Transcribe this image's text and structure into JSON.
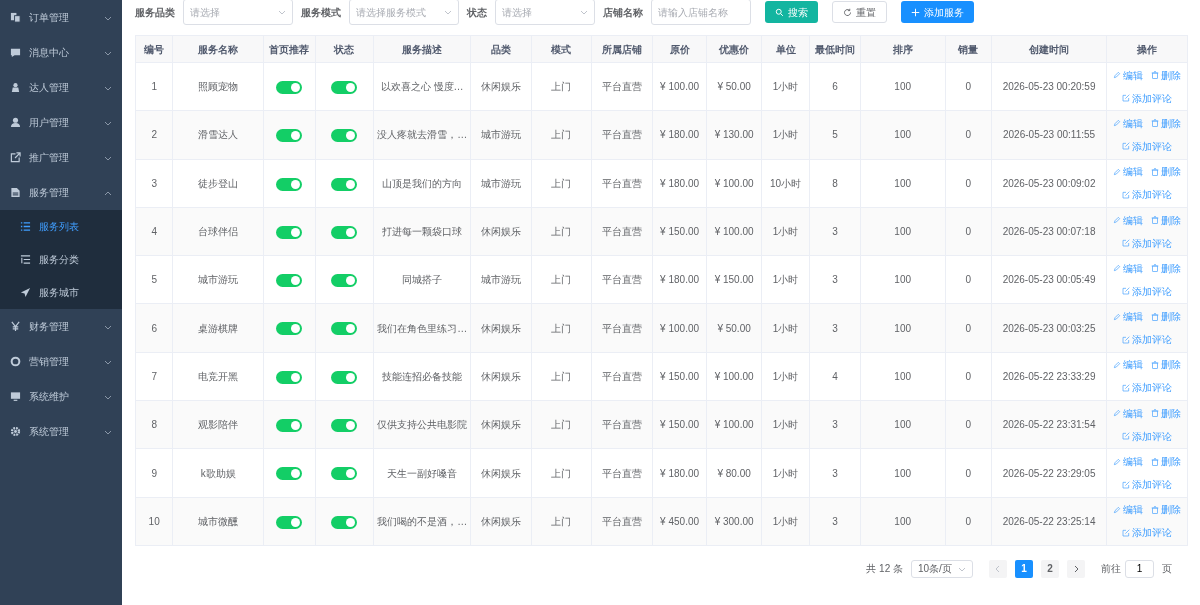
{
  "sidebar": {
    "items": [
      {
        "label": "订单管理",
        "expanded": false
      },
      {
        "label": "消息中心",
        "expanded": false
      },
      {
        "label": "达人管理",
        "expanded": false
      },
      {
        "label": "用户管理",
        "expanded": false
      },
      {
        "label": "推广管理",
        "expanded": false
      },
      {
        "label": "服务管理",
        "expanded": true,
        "children": [
          {
            "label": "服务列表",
            "selected": true
          },
          {
            "label": "服务分类",
            "selected": false
          },
          {
            "label": "服务城市",
            "selected": false
          }
        ]
      },
      {
        "label": "财务管理",
        "expanded": false
      },
      {
        "label": "营销管理",
        "expanded": false
      },
      {
        "label": "系统维护",
        "expanded": false
      },
      {
        "label": "系统管理",
        "expanded": false
      }
    ]
  },
  "filters": [
    {
      "label": "服务品类",
      "placeholder": "请选择",
      "kind": "select"
    },
    {
      "label": "服务模式",
      "placeholder": "请选择服务模式",
      "kind": "select"
    },
    {
      "label": "状态",
      "placeholder": "请选择",
      "kind": "select"
    },
    {
      "label": "店铺名称",
      "placeholder": "请输入店铺名称",
      "kind": "input"
    }
  ],
  "buttons": [
    {
      "label": "搜索",
      "kind": "search"
    },
    {
      "label": "重置",
      "kind": "reset"
    },
    {
      "label": "添加服务",
      "kind": "add"
    }
  ],
  "table": {
    "columns": [
      "编号",
      "服务名称",
      "首页推荐",
      "状态",
      "服务描述",
      "品类",
      "模式",
      "所属店铺",
      "原价",
      "优惠价",
      "单位",
      "最低时间",
      "排序",
      "销量",
      "创建时间",
      "操作"
    ],
    "rows": [
      {
        "id": "1",
        "name": "照顾宠物",
        "recommended": true,
        "enabled": true,
        "desc": "以欢喜之心 慢度…",
        "category": "休闲娱乐",
        "mode": "上门",
        "shop": "平台直营",
        "price": "¥ 100.00",
        "discount": "¥ 50.00",
        "unit": "1小时",
        "min": "6",
        "sort": "100",
        "sales": "0",
        "created": "2026-05-23 00:20:59",
        "actions": [
          "编辑",
          "删除",
          "添加评论"
        ]
      },
      {
        "id": "2",
        "name": "滑雪达人",
        "recommended": true,
        "enabled": true,
        "desc": "没人疼就去滑雪，…",
        "category": "城市游玩",
        "mode": "上门",
        "shop": "平台直营",
        "price": "¥ 180.00",
        "discount": "¥ 130.00",
        "unit": "1小时",
        "min": "5",
        "sort": "100",
        "sales": "0",
        "created": "2026-05-23 00:11:55",
        "actions": [
          "编辑",
          "删除",
          "添加评论"
        ]
      },
      {
        "id": "3",
        "name": "徒步登山",
        "recommended": true,
        "enabled": true,
        "desc": "山顶是我们的方向",
        "category": "城市游玩",
        "mode": "上门",
        "shop": "平台直营",
        "price": "¥ 180.00",
        "discount": "¥ 100.00",
        "unit": "10小时",
        "min": "8",
        "sort": "100",
        "sales": "0",
        "created": "2026-05-23 00:09:02",
        "actions": [
          "编辑",
          "删除",
          "添加评论"
        ]
      },
      {
        "id": "4",
        "name": "台球伴侣",
        "recommended": true,
        "enabled": true,
        "desc": "打进每一颗袋口球",
        "category": "休闲娱乐",
        "mode": "上门",
        "shop": "平台直营",
        "price": "¥ 150.00",
        "discount": "¥ 100.00",
        "unit": "1小时",
        "min": "3",
        "sort": "100",
        "sales": "0",
        "created": "2026-05-23 00:07:18",
        "actions": [
          "编辑",
          "删除",
          "添加评论"
        ]
      },
      {
        "id": "5",
        "name": "城市游玩",
        "recommended": true,
        "enabled": true,
        "desc": "同城搭子",
        "category": "城市游玩",
        "mode": "上门",
        "shop": "平台直营",
        "price": "¥ 180.00",
        "discount": "¥ 150.00",
        "unit": "1小时",
        "min": "3",
        "sort": "100",
        "sales": "0",
        "created": "2026-05-23 00:05:49",
        "actions": [
          "编辑",
          "删除",
          "添加评论"
        ]
      },
      {
        "id": "6",
        "name": "桌游棋牌",
        "recommended": true,
        "enabled": true,
        "desc": "我们在角色里练习…",
        "category": "休闲娱乐",
        "mode": "上门",
        "shop": "平台直营",
        "price": "¥ 100.00",
        "discount": "¥ 50.00",
        "unit": "1小时",
        "min": "3",
        "sort": "100",
        "sales": "0",
        "created": "2026-05-23 00:03:25",
        "actions": [
          "编辑",
          "删除",
          "添加评论"
        ]
      },
      {
        "id": "7",
        "name": "电竞开黑",
        "recommended": true,
        "enabled": true,
        "desc": "技能连招必备技能",
        "category": "休闲娱乐",
        "mode": "上门",
        "shop": "平台直营",
        "price": "¥ 150.00",
        "discount": "¥ 100.00",
        "unit": "1小时",
        "min": "4",
        "sort": "100",
        "sales": "0",
        "created": "2026-05-22 23:33:29",
        "actions": [
          "编辑",
          "删除",
          "添加评论"
        ]
      },
      {
        "id": "8",
        "name": "观影陪伴",
        "recommended": true,
        "enabled": true,
        "desc": "仅供支持公共电影院",
        "category": "休闲娱乐",
        "mode": "上门",
        "shop": "平台直营",
        "price": "¥ 150.00",
        "discount": "¥ 100.00",
        "unit": "1小时",
        "min": "3",
        "sort": "100",
        "sales": "0",
        "created": "2026-05-22 23:31:54",
        "actions": [
          "编辑",
          "删除",
          "添加评论"
        ]
      },
      {
        "id": "9",
        "name": "k歌助娱",
        "recommended": true,
        "enabled": true,
        "desc": "天生一副好嗓音",
        "category": "休闲娱乐",
        "mode": "上门",
        "shop": "平台直营",
        "price": "¥ 180.00",
        "discount": "¥ 80.00",
        "unit": "1小时",
        "min": "3",
        "sort": "100",
        "sales": "0",
        "created": "2026-05-22 23:29:05",
        "actions": [
          "编辑",
          "删除",
          "添加评论"
        ]
      },
      {
        "id": "10",
        "name": "城市微醺",
        "recommended": true,
        "enabled": true,
        "desc": "我们喝的不是酒，…",
        "category": "休闲娱乐",
        "mode": "上门",
        "shop": "平台直营",
        "price": "¥ 450.00",
        "discount": "¥ 300.00",
        "unit": "1小时",
        "min": "3",
        "sort": "100",
        "sales": "0",
        "created": "2026-05-22 23:25:14",
        "actions": [
          "编辑",
          "删除",
          "添加评论"
        ]
      }
    ]
  },
  "pagination": {
    "total": "共 12 条",
    "page_size": "10条/页",
    "pages": [
      {
        "label": "1",
        "selected": true
      },
      {
        "label": "2",
        "selected": false
      }
    ],
    "goto_label": "前往",
    "goto_value": "1",
    "goto_suffix": "页"
  }
}
